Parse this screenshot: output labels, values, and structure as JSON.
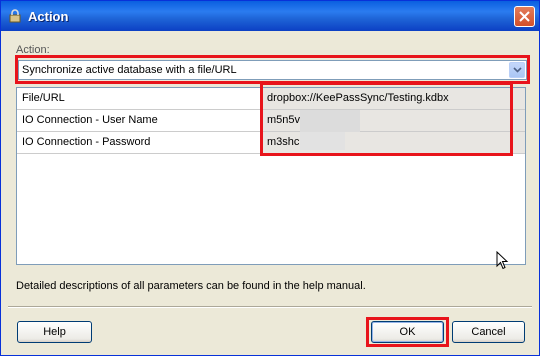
{
  "window": {
    "title": "Action"
  },
  "action": {
    "label": "Action:",
    "selected": "Synchronize active database with a file/URL"
  },
  "parameters": {
    "rows": [
      {
        "name": "File/URL",
        "value": "dropbox://KeePassSync/Testing.kdbx"
      },
      {
        "name": "IO Connection - User Name",
        "value": "m5n5v"
      },
      {
        "name": "IO Connection - Password",
        "value": "m3shc"
      }
    ]
  },
  "description": "Detailed descriptions of all parameters can be found in the help manual.",
  "buttons": {
    "help": "Help",
    "ok": "OK",
    "cancel": "Cancel"
  },
  "colors": {
    "highlight": "#e8141b",
    "titlebar": "#0a5fe0",
    "face": "#ece9d8"
  }
}
